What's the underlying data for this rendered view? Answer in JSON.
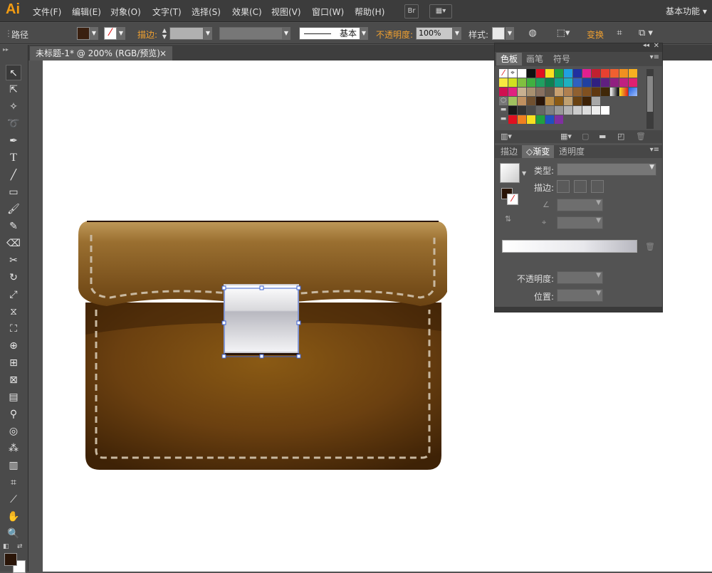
{
  "app": {
    "logo": "Ai",
    "workspace": "基本功能 ▾"
  },
  "menus": [
    "文件(F)",
    "编辑(E)",
    "对象(O)",
    "文字(T)",
    "选择(S)",
    "效果(C)",
    "视图(V)",
    "窗口(W)",
    "帮助(H)"
  ],
  "menu_buttons": {
    "bridge": "Br"
  },
  "control": {
    "selection_label": "路径",
    "stroke_label": "描边:",
    "brush_label": "基本",
    "opacity_label": "不透明度:",
    "opacity_value": "100%",
    "style_label": "样式:",
    "transform_label": "变换"
  },
  "document": {
    "tab_title": "未标题-1* @ 200% (RGB/预览)",
    "close": "×"
  },
  "panel": {
    "tabs_top": [
      "色板",
      "画笔",
      "符号"
    ],
    "tabs_bottom": [
      "描边",
      "渐变",
      "透明度"
    ],
    "type_label": "类型:",
    "stroke_label": "描边:",
    "opacity_label": "不透明度:",
    "position_label": "位置:"
  },
  "colors": {
    "accent": "#f0a030",
    "bag_dark": "#4a2a08",
    "bag_light": "#b88a45",
    "stitch": "#c8b8a0",
    "selection": "#3a5fd0"
  }
}
